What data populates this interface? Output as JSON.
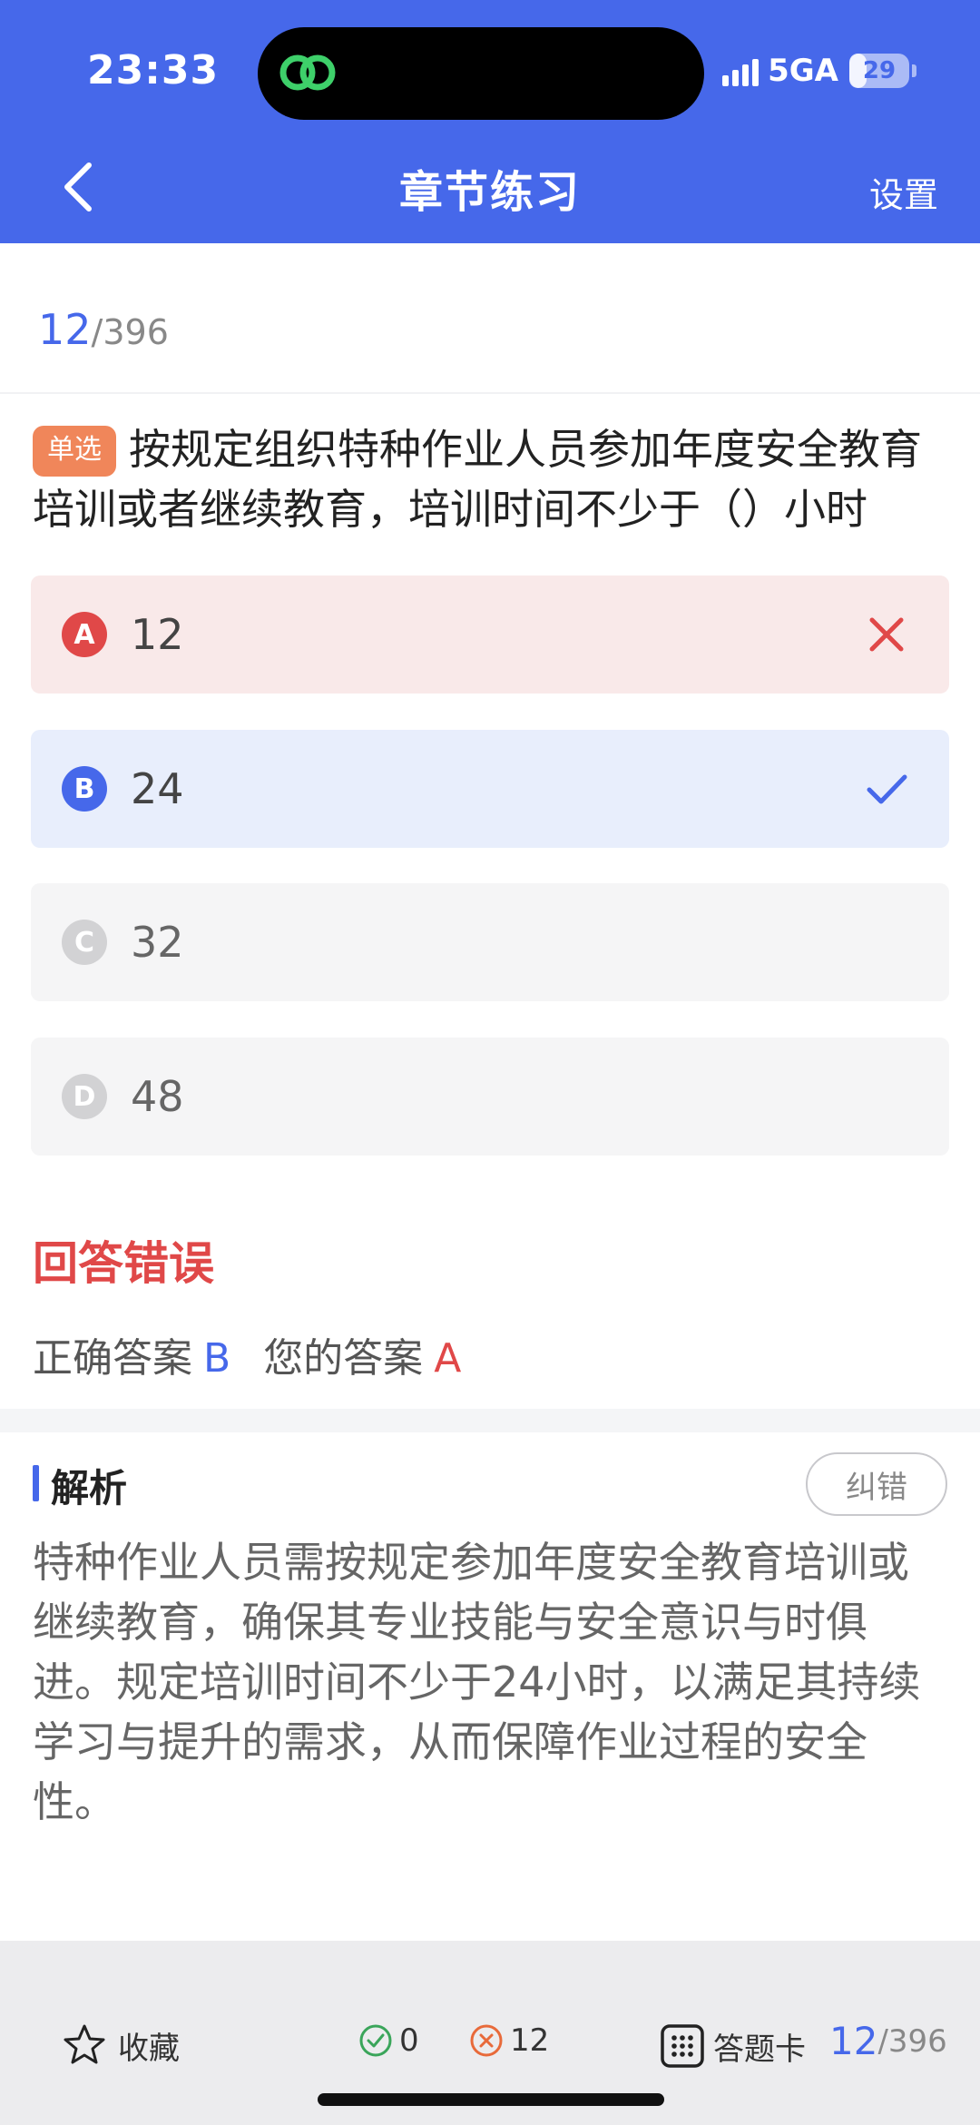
{
  "status_bar": {
    "time": "23:33",
    "network": "5GA",
    "battery": "29",
    "battery_level": 0.29
  },
  "nav": {
    "title": "章节练习",
    "settings_label": "设置"
  },
  "progress": {
    "current": "12",
    "total": "/396"
  },
  "question": {
    "type_tag": "单选",
    "text": "按规定组织特种作业人员参加年度安全教育培训或者继续教育，培训时间不少于（）小时"
  },
  "options": [
    {
      "letter": "A",
      "text": "12",
      "state": "wrong"
    },
    {
      "letter": "B",
      "text": "24",
      "state": "correct"
    },
    {
      "letter": "C",
      "text": "32",
      "state": "none"
    },
    {
      "letter": "D",
      "text": "48",
      "state": "none"
    }
  ],
  "result": {
    "title": "回答错误",
    "correct_label": "正确答案",
    "correct_value": "B",
    "your_label": "您的答案",
    "your_value": "A"
  },
  "analysis": {
    "title": "解析",
    "report_button": "纠错",
    "text": "特种作业人员需按规定参加年度安全教育培训或继续教育，确保其专业技能与安全意识与时俱进。规定培训时间不少于24小时，以满足其持续学习与提升的需求，从而保障作业过程的安全性。"
  },
  "bottom_bar": {
    "favorite_label": "收藏",
    "right_count": "0",
    "wrong_count": "12",
    "answer_card_label": "答题卡",
    "progress_current": "12",
    "progress_total": "/396"
  },
  "colors": {
    "brand": "#4668ea",
    "error": "#e04848",
    "tag": "#f0865a",
    "success": "#3aa55a"
  }
}
